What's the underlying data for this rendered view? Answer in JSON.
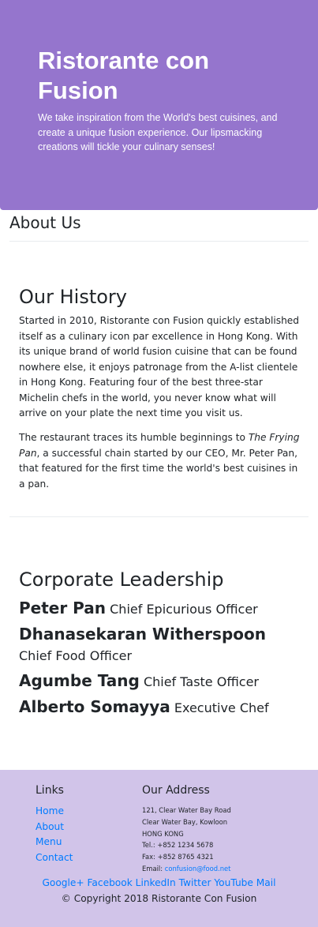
{
  "header": {
    "title": "Ristorante con Fusion",
    "tagline": "We take inspiration from the World's best cuisines, and create a unique fusion experience. Our lipsmacking creations will tickle your culinary senses!"
  },
  "about": {
    "title": "About Us"
  },
  "history": {
    "title": "Our History",
    "paragraph1": "Started in 2010, Ristorante con Fusion quickly established itself as a culinary icon par excellence in Hong Kong. With its unique brand of world fusion cuisine that can be found nowhere else, it enjoys patronage from the A-list clientele in Hong Kong. Featuring four of the best three-star Michelin chefs in the world, you never know what will arrive on your plate the next time you visit us.",
    "paragraph2_before": "The restaurant traces its humble beginnings to ",
    "paragraph2_em": "The Frying Pan",
    "paragraph2_after": ", a successful chain started by our CEO, Mr. Peter Pan, that featured for the first time the world's best cuisines in a pan."
  },
  "leadership": {
    "title": "Corporate Leadership",
    "leaders": [
      {
        "name": "Peter Pan",
        "role": "Chief Epicurious Officer"
      },
      {
        "name": "Dhanasekaran Witherspoon",
        "role": "Chief Food Officer"
      },
      {
        "name": "Agumbe Tang",
        "role": "Chief Taste Officer"
      },
      {
        "name": "Alberto Somayya",
        "role": "Executive Chef"
      }
    ]
  },
  "footer": {
    "links_title": "Links",
    "links": [
      "Home",
      "About",
      "Menu",
      "Contact"
    ],
    "address_title": "Our Address",
    "address_lines": [
      "121, Clear Water Bay Road",
      "Clear Water Bay, Kowloon",
      "HONG KONG",
      "Tel.: +852 1234 5678",
      "Fax: +852 8765 4321"
    ],
    "email_label": "Email: ",
    "email": "confusion@food.net",
    "social": [
      "Google+",
      "Facebook",
      "LinkedIn",
      "Twitter",
      "YouTube",
      "Mail"
    ],
    "copyright": "© Copyright 2018 Ristorante Con Fusion"
  },
  "colors": {
    "header_bg": "#9575cd",
    "footer_bg": "#d1c4e9",
    "link": "#007bff"
  }
}
